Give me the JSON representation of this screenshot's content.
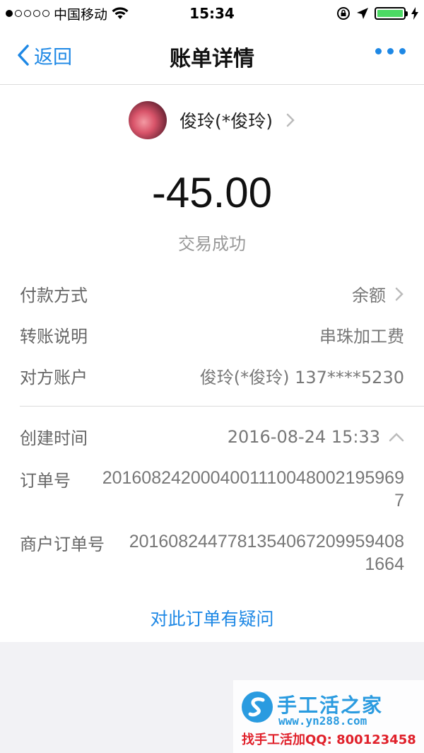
{
  "status_bar": {
    "carrier": "中国移动",
    "time": "15:34"
  },
  "nav": {
    "back_label": "返回",
    "title": "账单详情"
  },
  "party": {
    "name": "俊玲(*俊玲)"
  },
  "amount": "-45.00",
  "status": "交易成功",
  "details": [
    {
      "label": "付款方式",
      "value": "余额"
    },
    {
      "label": "转账说明",
      "value": "串珠加工费"
    },
    {
      "label": "对方账户",
      "value": "俊玲(*俊玲) 137****5230"
    },
    {
      "label": "创建时间",
      "value": "2016-08-24 15:33"
    },
    {
      "label": "订单号",
      "value": "20160824200040011100480021959697"
    },
    {
      "label": "商户订单号",
      "value": "20160824477813540672099594081664"
    }
  ],
  "question_link": "对此订单有疑问",
  "watermark": {
    "title": "手工活之家",
    "url": "www.yn288.com",
    "contact": "找手工活加QQ: 800123458"
  },
  "colors": {
    "accent": "#1e88e5",
    "battery": "#4cd964",
    "watermark_blue": "#2a9be0",
    "watermark_red": "#e0202a"
  }
}
